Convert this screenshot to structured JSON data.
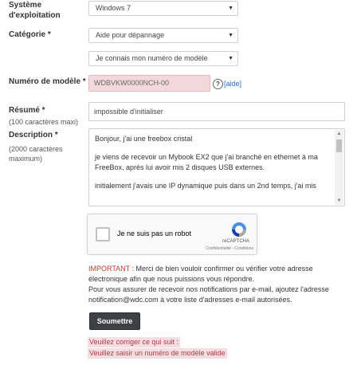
{
  "form": {
    "os_label": "Système d'exploitation",
    "os_value": "Windows 7",
    "category_label": "Catégorie *",
    "category_value": "Aide pour dépannage",
    "subcategory_value": "Je connais mon numéro de modèle",
    "model_label": "Numéro de modèle *",
    "model_value": "WDBVKW0000NCH-00",
    "model_help_icon": "question-circle-icon",
    "model_help_link": "[aide]",
    "summary_label": "Résumé *",
    "summary_hint": "(100 caractères maxi)",
    "summary_value": "impossible d'initialiser",
    "description_label": "Description *",
    "description_hint": "(2000 caractères maximum)",
    "description_paragraphs": [
      "Bonjour, j'ai une freebox cristal",
      "je viens de recevoir un Mybook EX2 que j'ai branché en ethernet à ma FreeBox, après lui avoir mis 2 disques USB externes.",
      "initialement j'avais une IP dynamique puis dans un 2nd temps, j'ai mis"
    ]
  },
  "captcha": {
    "label": "Je ne suis pas un robot",
    "brand": "reCAPTCHA",
    "links": "Confidentialité - Conditions",
    "logo_icon": "recaptcha-icon"
  },
  "notice": {
    "important": "IMPORTANT :",
    "line1_rest": " Merci de bien vouloir confirmer ou vérifier votre adresse électronique afin que nous puissions vous répondre.",
    "line2": "Pour vous assurer de recevoir nos notifications par e-mail, ajoutez l'adresse notification@wdc.com à votre liste d'adresses e-mail autorisées."
  },
  "submit_label": "Soumettre",
  "errors": {
    "intro": "Veuillez corriger ce qui suit :",
    "model": "Veuillez saisir un numéro de modèle valide"
  },
  "colors": {
    "error_bg": "#f3d8dc",
    "error_text": "#b03a48",
    "button_bg": "#3d4145",
    "link": "#2a6ebb"
  }
}
